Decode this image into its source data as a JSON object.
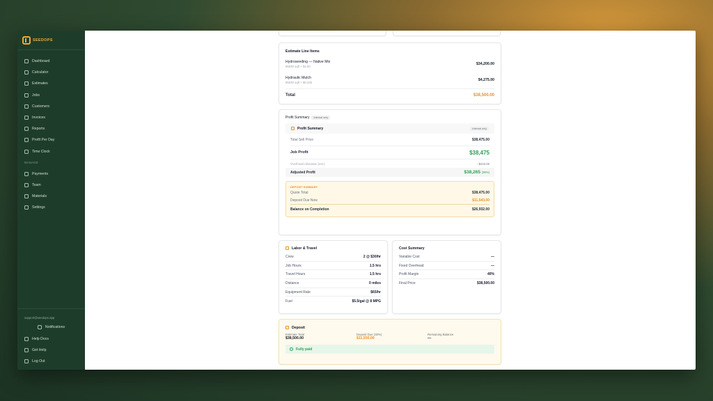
{
  "brand": {
    "name": "SEEDOPS"
  },
  "sidebar": {
    "items": [
      {
        "label": "Dashboard",
        "icon": "dashboard-icon"
      },
      {
        "label": "Calculator",
        "icon": "calculator-icon"
      },
      {
        "label": "Estimates",
        "icon": "document-icon"
      },
      {
        "label": "Jobs",
        "icon": "briefcase-icon"
      },
      {
        "label": "Customers",
        "icon": "users-icon"
      },
      {
        "label": "Invoices",
        "icon": "invoice-icon"
      },
      {
        "label": "Reports",
        "icon": "bar-chart-icon"
      },
      {
        "label": "Profit Per Day",
        "icon": "trend-icon"
      },
      {
        "label": "Time Clock",
        "icon": "clock-icon"
      }
    ],
    "section_label": "MANAGE",
    "manage_items": [
      {
        "label": "Payments",
        "icon": "card-icon"
      },
      {
        "label": "Team",
        "icon": "team-icon"
      },
      {
        "label": "Materials",
        "icon": "leaf-icon"
      },
      {
        "label": "Settings",
        "icon": "gear-icon"
      }
    ],
    "support_email": "support@seedops.app",
    "bottom_items": [
      {
        "label": "Notifications",
        "icon": "bell-icon"
      },
      {
        "label": "Help Docs",
        "icon": "book-icon"
      },
      {
        "label": "Get Help",
        "icon": "chat-icon"
      },
      {
        "label": "Log Out",
        "icon": "logout-icon"
      }
    ]
  },
  "line_items": {
    "title": "Estimate Line Items",
    "items": [
      {
        "name": "Hydroseeding — Native Mix",
        "detail": "85030 sqft × $4.00",
        "amount": "$34,200.00"
      },
      {
        "name": "Hydraulic Mulch",
        "detail": "85030 sqft × $0.045",
        "amount": "$4,275.00"
      }
    ],
    "total_label": "Total",
    "total_value": "$38,500.00"
  },
  "profit": {
    "title": "Profit Summary",
    "badge": "Internal only",
    "inner_title": "Profit Summary",
    "inner_badge": "Internal only",
    "sell_label": "Total Sell Price",
    "sell_value": "$38,475.00",
    "job_profit_label": "Job Profit",
    "job_profit_value": "$38,475",
    "overhead_label": "Overhead Allocation (est.)",
    "overhead_value": "- $210.00",
    "adjusted_label": "Adjusted Profit",
    "adjusted_value": "$38,265",
    "adjusted_pct": "(99%)"
  },
  "deposit_summary": {
    "title": "DEPOSIT SUMMARY",
    "quote_label": "Quote Total",
    "quote_value": "$38,475.00",
    "due_label": "Deposit Due Now",
    "due_value": "$11,543.00",
    "balance_label": "Balance on Completion",
    "balance_value": "$26,932.00"
  },
  "labor": {
    "title": "Labor & Travel",
    "rows": [
      {
        "k": "Crew",
        "v": "2 @ $30/hr"
      },
      {
        "k": "Job Hours",
        "v": "1.5 hrs"
      },
      {
        "k": "Travel Hours",
        "v": "1.5 hrs"
      },
      {
        "k": "Distance",
        "v": "0 miles"
      },
      {
        "k": "Equipment Rate",
        "v": "$65/hr"
      },
      {
        "k": "Fuel",
        "v": "$5.5/gal @ 8 MPG"
      }
    ]
  },
  "cost": {
    "title": "Cost Summary",
    "rows": [
      {
        "k": "Variable Cost",
        "v": "—"
      },
      {
        "k": "Fixed Overhead",
        "v": "—"
      },
      {
        "k": "Profit Margin",
        "v": "40%"
      },
      {
        "k": "Final Price",
        "v": "$38,500.00"
      }
    ]
  },
  "deposit": {
    "title": "Deposit",
    "estimate_label": "Estimate Total",
    "estimate_value": "$38,500.00",
    "due_label": "Deposit Due (30%)",
    "due_value": "$11,550.00",
    "remaining_label": "Remaining Balance",
    "remaining_value": "—",
    "status": "Fully paid"
  }
}
